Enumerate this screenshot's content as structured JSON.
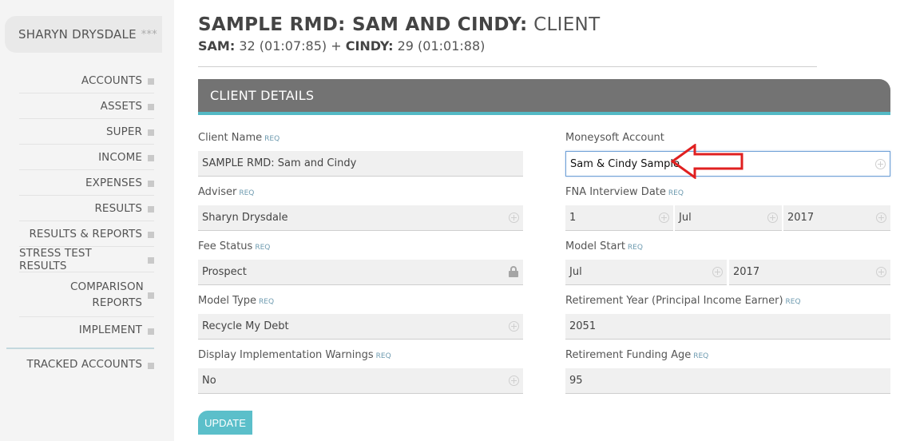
{
  "sidebar": {
    "user_name": "SHARYN DRYSDALE",
    "user_stars": "***",
    "items": [
      {
        "label": "ACCOUNTS"
      },
      {
        "label": "ASSETS"
      },
      {
        "label": "SUPER"
      },
      {
        "label": "INCOME"
      },
      {
        "label": "EXPENSES"
      },
      {
        "label": "RESULTS"
      },
      {
        "label": "RESULTS & REPORTS"
      },
      {
        "label": "STRESS TEST RESULTS"
      },
      {
        "label": "COMPARISON REPORTS"
      },
      {
        "label": "IMPLEMENT"
      }
    ],
    "tracked_accounts": "TRACKED ACCOUNTS"
  },
  "header": {
    "title_bold": "SAMPLE RMD: SAM AND CINDY:",
    "title_light": "CLIENT",
    "person1_name": "SAM:",
    "person1_detail": "32 (01:07:85) +",
    "person2_name": "CINDY:",
    "person2_detail": "29 (01:01:88)"
  },
  "panel": {
    "title": "CLIENT DETAILS",
    "req": "REQ",
    "client_name": {
      "label": "Client Name",
      "value": "SAMPLE RMD: Sam and Cindy"
    },
    "adviser": {
      "label": "Adviser",
      "value": "Sharyn Drysdale"
    },
    "fee_status": {
      "label": "Fee Status",
      "value": "Prospect"
    },
    "model_type": {
      "label": "Model Type",
      "value": "Recycle My Debt"
    },
    "display_warnings": {
      "label": "Display Implementation Warnings",
      "value": "No"
    },
    "moneysoft": {
      "label": "Moneysoft Account",
      "value": "Sam & Cindy Sample"
    },
    "fna_date": {
      "label": "FNA Interview Date",
      "day": "1",
      "month": "Jul",
      "year": "2017"
    },
    "model_start": {
      "label": "Model Start",
      "month": "Jul",
      "year": "2017"
    },
    "retirement_year": {
      "label": "Retirement Year (Principal Income Earner)",
      "value": "2051"
    },
    "retirement_age": {
      "label": "Retirement Funding Age",
      "value": "95"
    },
    "update_label": "UPDATE"
  },
  "colors": {
    "accent": "#53b9c5",
    "panel_header": "#737373",
    "arrow": "#e02020"
  }
}
